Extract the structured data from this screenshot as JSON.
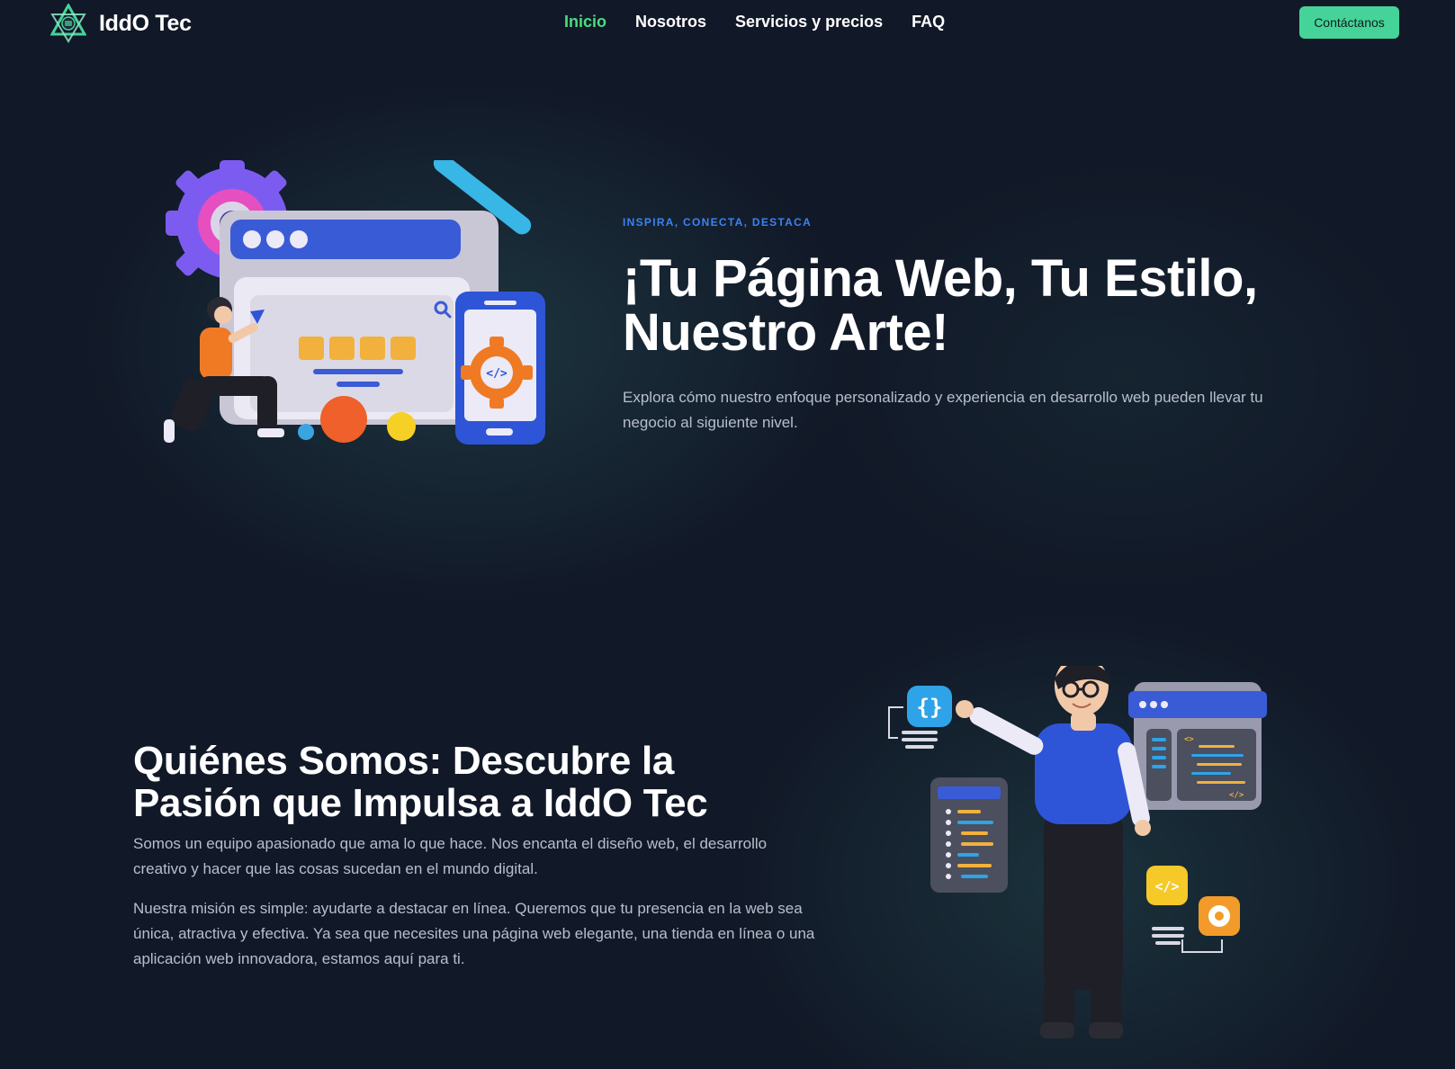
{
  "brand": {
    "name": "IddO Tec"
  },
  "nav": {
    "items": [
      {
        "label": "Inicio",
        "active": true
      },
      {
        "label": "Nosotros",
        "active": false
      },
      {
        "label": "Servicios y precios",
        "active": false
      },
      {
        "label": "FAQ",
        "active": false
      }
    ],
    "cta_label": "Contáctanos"
  },
  "hero": {
    "eyebrow": "INSPIRA, CONECTA, DESTACA",
    "title_line1": "¡Tu Página Web, Tu Estilo,",
    "title_line2": "Nuestro Arte!",
    "description": "Explora cómo nuestro enfoque personalizado y experiencia en desarrollo web pueden llevar tu negocio al siguiente nivel."
  },
  "about": {
    "title_line1": "Quiénes Somos: Descubre la",
    "title_line2": "Pasión que Impulsa a IddO Tec",
    "paragraph1": "Somos un equipo apasionado que ama lo que hace. Nos encanta el diseño web, el desarrollo creativo y hacer que las cosas sucedan en el mundo digital.",
    "paragraph2": "Nuestra misión es simple: ayudarte a destacar en línea. Queremos que tu presencia en la web sea única, atractiva y efectiva. Ya sea que necesites una página web elegante, una tienda en línea o una aplicación web innovadora, estamos aquí para ti."
  },
  "colors": {
    "background": "#111827",
    "accent_green": "#46d39a",
    "active_link": "#4ade80",
    "eyebrow_blue": "#3b82f6",
    "body_text": "#b8bfcc"
  },
  "icons": {
    "logo": "triangle-logo-icon",
    "hero_art": "web-design-illustration",
    "about_art": "developer-illustration"
  }
}
